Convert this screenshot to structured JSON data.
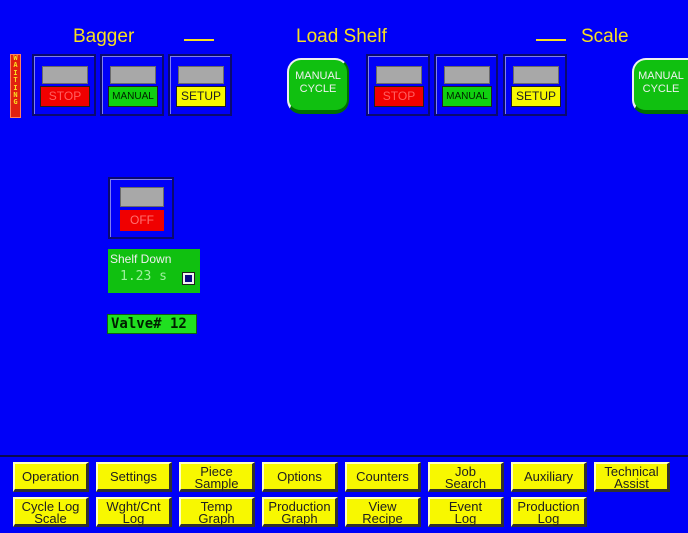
{
  "header": {
    "titles": [
      "Bagger",
      "Load Shelf",
      "Scale"
    ]
  },
  "status": {
    "waiting_label": "W\nA\nI\nT\nI\nN\nG"
  },
  "station_buttons": {
    "stop_label": "STOP",
    "manual_label": "MANUAL",
    "setup_label": "SETUP",
    "cycle_label_line1": "MANUAL",
    "cycle_label_line2": "CYCLE"
  },
  "shelf": {
    "off_label": "OFF",
    "panel_label": "Shelf Down",
    "panel_value": "1.23 s",
    "valve_label": "Valve# 12"
  },
  "nav": {
    "row1": [
      {
        "label": "Operation"
      },
      {
        "label": "Settings"
      },
      {
        "label": "Piece\nSample"
      },
      {
        "label": "Options"
      },
      {
        "label": "Counters"
      },
      {
        "label": "Job\nSearch"
      },
      {
        "label": "Auxiliary"
      },
      {
        "label": "Technical\nAssist"
      }
    ],
    "row2": [
      {
        "label": "Cycle Log\nScale"
      },
      {
        "label": "Wght/Cnt\nLog"
      },
      {
        "label": "Temp\nGraph"
      },
      {
        "label": "Production\nGraph"
      },
      {
        "label": "View\nRecipe"
      },
      {
        "label": "Event\nLog"
      },
      {
        "label": "Production\nLog"
      }
    ]
  },
  "colors": {
    "background": "#0000f8",
    "header_text": "#f8e020",
    "stop": "#f00000",
    "manual": "#10d010",
    "setup": "#f8f800",
    "nav_button": "#f8f800"
  }
}
